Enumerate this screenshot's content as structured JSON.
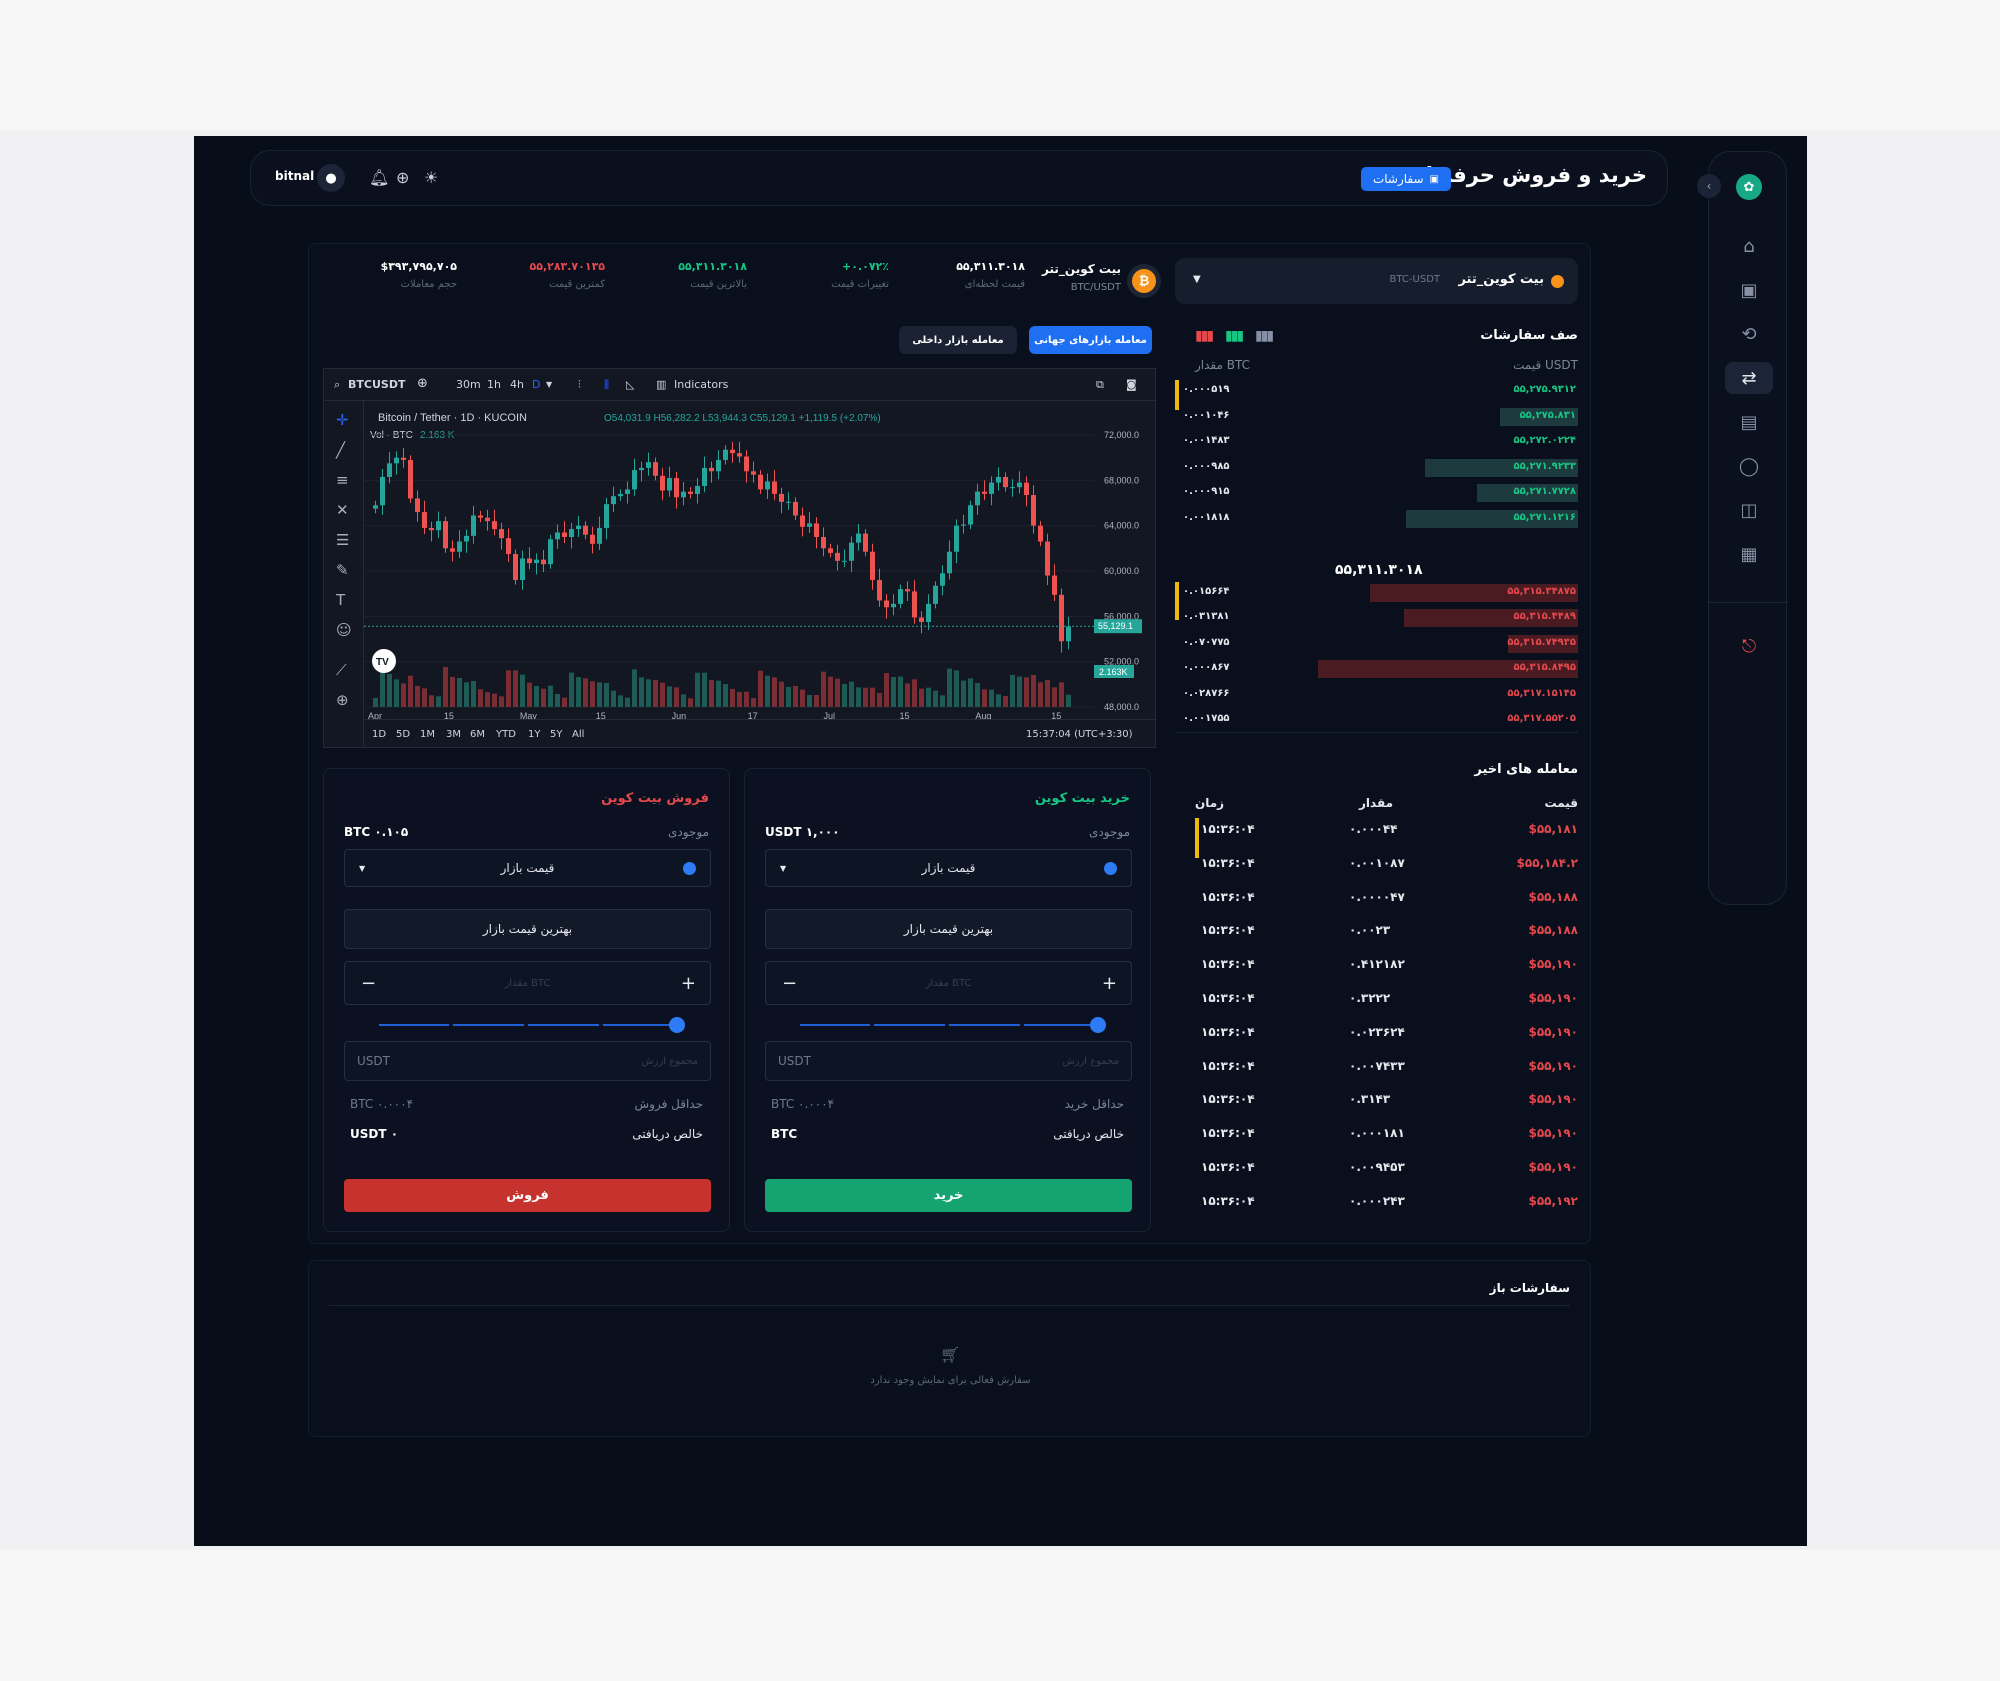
{
  "app": {
    "title": "خرید و فروش حرفه ای",
    "orders_label": "سفارشات",
    "user": "bitnal"
  },
  "sidebar": {
    "items": [
      "home-icon",
      "wallet-icon",
      "exchange-icon",
      "trade-icon",
      "chart-icon",
      "support-icon",
      "shop-icon",
      "gift-icon"
    ],
    "active": 3
  },
  "ticker": {
    "pair_name": "بیت کوین_تتر",
    "pair_sub": "BTC/USDT",
    "stats": [
      {
        "value": "۵۵,۳۱۱.۳۰۱۸",
        "label": "قیمت لحظه‌ای",
        "color": "#ffffff"
      },
      {
        "value": "+۰.۰۷۲٪",
        "label": "تغییرات قیمت",
        "color": "#16c784"
      },
      {
        "value": "۵۵,۳۱۱.۳۰۱۸",
        "label": "بالاترین قیمت",
        "color": "#16c784"
      },
      {
        "value": "۵۵,۲۸۳.۷۰۱۳۵",
        "label": "کمترین قیمت",
        "color": "#e5484d"
      },
      {
        "value": "$۳۹۳,۷۹۵,۷۰۵",
        "label": "حجم معاملات",
        "color": "#ffffff"
      }
    ]
  },
  "selector": {
    "name": "بیت کوین_تتر",
    "sub": "BTC-USDT"
  },
  "market_tabs": {
    "global": "معامله بازارهای جهانی",
    "local": "معامله بازار داخلی"
  },
  "chart": {
    "symbol": "BTCUSDT",
    "intervals": [
      "30m",
      "1h",
      "4h",
      "D"
    ],
    "indicators": "Indicators",
    "title": "Bitcoin / Tether · 1D · KUCOIN",
    "ohlc": "O54,031.9 H56,282.2 L53,944.3 C55,129.1 +1,119.5 (+2.07%)",
    "vol_label": "Vol · BTC",
    "vol_value": "2.163 K",
    "last_price": "55,129.1",
    "last_vol": "2.163K",
    "time": "15:37:04 (UTC+3:30)",
    "ranges": [
      "1D",
      "5D",
      "1M",
      "3M",
      "6M",
      "YTD",
      "1Y",
      "5Y",
      "All"
    ]
  },
  "chart_data": {
    "type": "candlestick",
    "x_labels": [
      "Apr",
      "15",
      "May",
      "15",
      "Jun",
      "17",
      "Jul",
      "15",
      "Aug",
      "15"
    ],
    "y_ticks": [
      "72,000.0",
      "68,000.0",
      "64,000.0",
      "60,000.0",
      "56,000.0",
      "52,000.0",
      "48,000.0"
    ],
    "ylim": [
      48000,
      72000
    ],
    "closes": [
      65800,
      68300,
      69500,
      70000,
      69800,
      66400,
      65200,
      63800,
      63600,
      64400,
      62000,
      61700,
      62600,
      63100,
      64900,
      64700,
      64400,
      63700,
      62900,
      61500,
      59200,
      61100,
      60700,
      61000,
      60600,
      62800,
      63400,
      63000,
      63700,
      64000,
      63200,
      62400,
      63800,
      65900,
      66600,
      66800,
      67200,
      68900,
      69100,
      69600,
      68400,
      67100,
      68200,
      66500,
      67000,
      66800,
      67500,
      69100,
      68800,
      69800,
      70700,
      70400,
      70100,
      68800,
      68500,
      67200,
      67900,
      66800,
      66100,
      66100,
      64900,
      63900,
      64200,
      63000,
      62000,
      61600,
      60900,
      60900,
      62500,
      63300,
      61700,
      59200,
      57400,
      56800,
      57100,
      58400,
      58200,
      55900,
      55500,
      57100,
      58700,
      59800,
      61700,
      64000,
      64100,
      65800,
      67000,
      66800,
      67800,
      68300,
      67400,
      67400,
      67800,
      66700,
      64000,
      62600,
      59600,
      57900,
      53800,
      55100
    ]
  },
  "orderbook": {
    "title": "صف سفارشات",
    "price_header": "قیمت USDT",
    "amount_header": "مقدار BTC",
    "mid": "۵۵,۳۱۱.۳۰۱۸",
    "asks": [
      {
        "price": "۵۵,۲۷۵.۹۳۱۲",
        "amount": "۰.۰۰۰۵۱۹",
        "depth": 0
      },
      {
        "price": "۵۵,۲۷۵.۸۳۱",
        "amount": "۰.۰۰۱۰۴۶",
        "depth": 0.3
      },
      {
        "price": "۵۵,۲۷۲.۰۲۲۴",
        "amount": "۰.۰۰۱۴۸۳",
        "depth": 0
      },
      {
        "price": "۵۵,۲۷۱.۹۲۳۳",
        "amount": "۰.۰۰۰۹۸۵",
        "depth": 0.59
      },
      {
        "price": "۵۵,۲۷۱.۷۷۲۸",
        "amount": "۰.۰۰۰۹۱۵",
        "depth": 0.39
      },
      {
        "price": "۵۵,۲۷۱.۱۲۱۶",
        "amount": "۰.۰۰۱۸۱۸",
        "depth": 0.66
      }
    ],
    "bids": [
      {
        "price": "۵۵,۳۱۵.۳۴۸۷۵",
        "amount": "۰.۰۱۵۶۶۴",
        "depth": 0.8
      },
      {
        "price": "۵۵,۳۱۵.۴۴۸۹",
        "amount": "۰.۰۳۱۳۸۱",
        "depth": 0.67
      },
      {
        "price": "۵۵,۳۱۵.۷۴۹۳۵",
        "amount": "۰.۰۷۰۷۷۵",
        "depth": 0.27
      },
      {
        "price": "۵۵,۳۱۵.۸۴۹۵",
        "amount": "۰.۰۰۰۸۶۷",
        "depth": 1.0
      },
      {
        "price": "۵۵,۳۱۷.۱۵۱۴۵",
        "amount": "۰.۰۲۸۷۶۶",
        "depth": 0
      },
      {
        "price": "۵۵,۳۱۷.۵۵۲۰۵",
        "amount": "۰.۰۰۱۷۵۵",
        "depth": 0
      }
    ]
  },
  "recent_trades": {
    "title": "معامله های اخیر",
    "headers": {
      "price": "قیمت",
      "amount": "مقدار",
      "time": "زمان"
    },
    "rows": [
      {
        "price": "$۵۵,۱۸۱",
        "amount": "۰.۰۰۰۴۴",
        "time": "۱۵:۳۶:۰۴"
      },
      {
        "price": "$۵۵,۱۸۴.۲",
        "amount": "۰.۰۰۱۰۸۷",
        "time": "۱۵:۳۶:۰۴"
      },
      {
        "price": "$۵۵,۱۸۸",
        "amount": "۰.۰۰۰۰۴۷",
        "time": "۱۵:۳۶:۰۴"
      },
      {
        "price": "$۵۵,۱۸۸",
        "amount": "۰.۰۰۲۳",
        "time": "۱۵:۳۶:۰۴"
      },
      {
        "price": "$۵۵,۱۹۰",
        "amount": "۰.۴۱۲۱۸۲",
        "time": "۱۵:۳۶:۰۴"
      },
      {
        "price": "$۵۵,۱۹۰",
        "amount": "۰.۳۲۲۲",
        "time": "۱۵:۳۶:۰۴"
      },
      {
        "price": "$۵۵,۱۹۰",
        "amount": "۰.۰۲۳۶۲۴",
        "time": "۱۵:۳۶:۰۴"
      },
      {
        "price": "$۵۵,۱۹۰",
        "amount": "۰.۰۰۷۴۳۳",
        "time": "۱۵:۳۶:۰۴"
      },
      {
        "price": "$۵۵,۱۹۰",
        "amount": "۰.۳۱۴۳",
        "time": "۱۵:۳۶:۰۴"
      },
      {
        "price": "$۵۵,۱۹۰",
        "amount": "۰.۰۰۰۱۸۱",
        "time": "۱۵:۳۶:۰۴"
      },
      {
        "price": "$۵۵,۱۹۰",
        "amount": "۰.۰۰۹۴۵۳",
        "time": "۱۵:۳۶:۰۴"
      },
      {
        "price": "$۵۵,۱۹۲",
        "amount": "۰.۰۰۰۲۴۳",
        "time": "۱۵:۳۶:۰۴"
      }
    ]
  },
  "buy": {
    "title": "خرید بیت کوین",
    "balance_label": "موجودی",
    "balance": "USDT ۱,۰۰۰",
    "type": "قیمت بازار",
    "best": "بهترین قیمت بازار",
    "amount_ph": "مقدار BTC",
    "total_ph": "مجموع ارزش",
    "total_unit": "USDT",
    "min_label": "حداقل خرید",
    "min_value": "BTC ۰.۰۰۰۴",
    "net_label": "خالص دریافتی",
    "net_value": "BTC",
    "action": "خرید"
  },
  "sell": {
    "title": "فروش بیت کوین",
    "balance_label": "موجودی",
    "balance": "BTC ۰.۱۰۵",
    "type": "قیمت بازار",
    "best": "بهترین قیمت بازار",
    "amount_ph": "مقدار BTC",
    "total_ph": "مجموع ارزش",
    "total_unit": "USDT",
    "min_label": "حداقل فروش",
    "min_value": "BTC ۰.۰۰۰۴",
    "net_label": "خالص دریافتی",
    "net_value": "USDT ۰",
    "action": "فروش"
  },
  "open_orders": {
    "title": "سفارشات باز",
    "empty": "سفارش فعالی برای نمایش وجود ندارد"
  },
  "colors": {
    "accent": "#1f6ff2",
    "buy": "#16a372",
    "sell": "#c6322d",
    "up": "#26a69a",
    "down": "#ef5350",
    "warning": "#f0b90b"
  }
}
